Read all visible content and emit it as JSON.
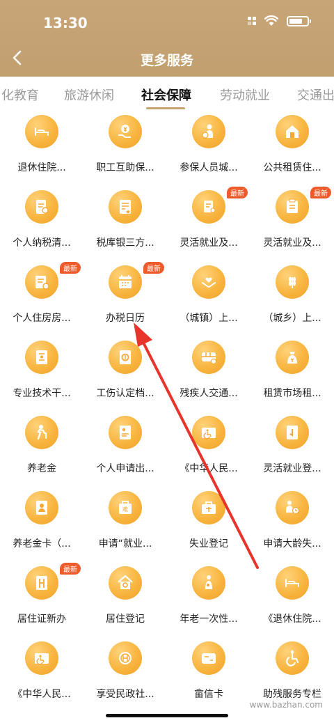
{
  "status_bar": {
    "time": "13:30"
  },
  "nav": {
    "title": "更多服务"
  },
  "tabs": [
    {
      "label": "化教育"
    },
    {
      "label": "旅游休闲"
    },
    {
      "label": "社会保障",
      "active": true
    },
    {
      "label": "劳动就业"
    },
    {
      "label": "交通出"
    }
  ],
  "badge_text": "最新",
  "services": [
    {
      "label": "退休住院...",
      "icon": "bed-icon"
    },
    {
      "label": "职工互助保...",
      "icon": "money-hand-icon"
    },
    {
      "label": "参保人员城...",
      "icon": "person-coin-icon"
    },
    {
      "label": "公共租赁住...",
      "icon": "house-icon"
    },
    {
      "label": "个人纳税清...",
      "icon": "tax-doc-icon"
    },
    {
      "label": "税库银三方...",
      "icon": "bank-doc-icon"
    },
    {
      "label": "灵活就业及...",
      "icon": "flex-job-icon",
      "badge": true
    },
    {
      "label": "灵活就业及...",
      "icon": "flex-job-doc-icon",
      "badge": true
    },
    {
      "label": "个人住房房...",
      "icon": "housing-doc-icon",
      "badge": true
    },
    {
      "label": "办税日历",
      "icon": "calendar-icon",
      "badge": true
    },
    {
      "label": "（城镇）上...",
      "icon": "hands-heart-icon"
    },
    {
      "label": "（城乡）上...",
      "icon": "wheat-icon"
    },
    {
      "label": "专业技术干...",
      "icon": "certificate-icon"
    },
    {
      "label": "工伤认定档...",
      "icon": "file-seal-icon"
    },
    {
      "label": "残疾人交通...",
      "icon": "bus-icon"
    },
    {
      "label": "租赁市场租...",
      "icon": "money-bag-icon"
    },
    {
      "label": "养老金",
      "icon": "elderly-icon"
    },
    {
      "label": "个人申请出...",
      "icon": "apply-doc-icon"
    },
    {
      "label": "《中华人民...",
      "icon": "disability-card-icon"
    },
    {
      "label": "灵活就业登...",
      "icon": "register-doc-icon"
    },
    {
      "label": "养老金卡（...",
      "icon": "id-card-icon"
    },
    {
      "label": "申请“就业...",
      "icon": "bag-icon"
    },
    {
      "label": "失业登记",
      "icon": "briefcase-icon"
    },
    {
      "label": "申请大龄失...",
      "icon": "people-clock-icon"
    },
    {
      "label": "居住证新办",
      "icon": "residence-doc-icon",
      "badge": true
    },
    {
      "label": "居住登记",
      "icon": "home-register-icon"
    },
    {
      "label": "年老一次性...",
      "icon": "elder-person-icon"
    },
    {
      "label": "《退休住院...",
      "icon": "bed-icon"
    },
    {
      "label": "《中华人民...",
      "icon": "disability-card-icon"
    },
    {
      "label": "享受民政社...",
      "icon": "welfare-icon"
    },
    {
      "label": "畲信卡",
      "icon": "card-icon"
    },
    {
      "label": "助残服务专栏",
      "icon": "wheelchair-icon"
    }
  ],
  "watermark": "www.bazhan.com",
  "colors": {
    "header": "#c7a577",
    "icon_orange": "#f8b540",
    "badge": "#ee5b2a",
    "arrow": "#e8342b"
  }
}
